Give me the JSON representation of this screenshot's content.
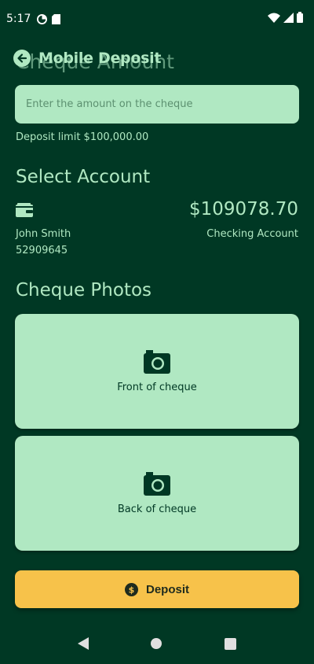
{
  "status_bar": {
    "time": "5:17"
  },
  "app_bar": {
    "title": "Mobile Deposit"
  },
  "cheque_amount": {
    "heading": "Cheque Amount",
    "placeholder": "Enter the amount on the cheque",
    "limit_text": "Deposit limit $100,000.00"
  },
  "select_account": {
    "heading": "Select Account",
    "balance": "$109078.70",
    "holder_name": "John Smith",
    "account_number": "52909645",
    "account_type": "Checking Account"
  },
  "cheque_photos": {
    "heading": "Cheque Photos",
    "front_label": "Front of cheque",
    "back_label": "Back of cheque"
  },
  "deposit_button": {
    "label": "Deposit"
  },
  "colors": {
    "background": "#003824",
    "accent": "#b0e8c2",
    "button": "#f7c24a"
  }
}
